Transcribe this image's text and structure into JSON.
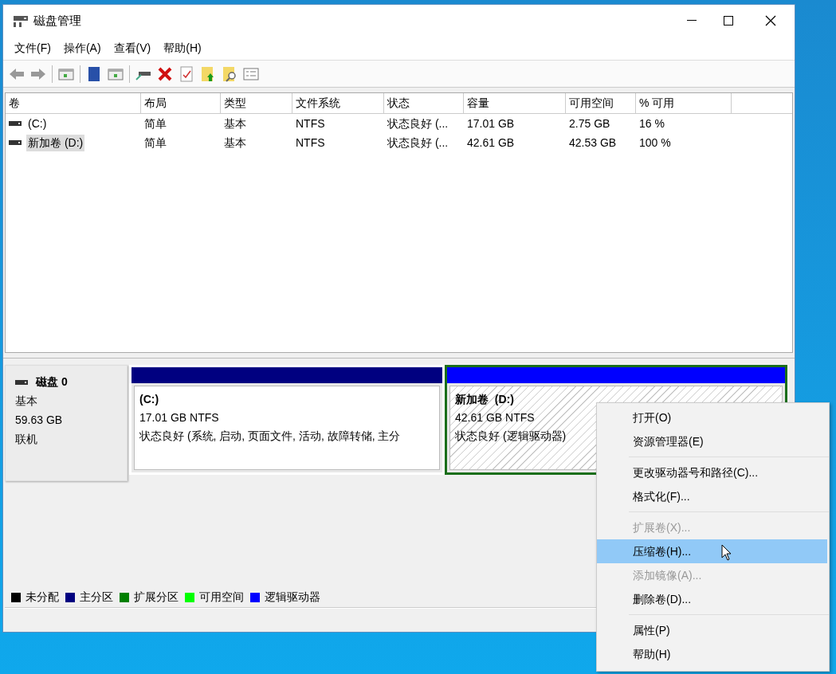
{
  "window": {
    "title": "磁盘管理"
  },
  "menu_bar": [
    "文件(F)",
    "操作(A)",
    "查看(V)",
    "帮助(H)"
  ],
  "table": {
    "columns": [
      "卷",
      "布局",
      "类型",
      "文件系统",
      "状态",
      "容量",
      "可用空间",
      "% 可用"
    ],
    "rows": [
      {
        "selected": false,
        "cells": [
          "(C:)",
          "简单",
          "基本",
          "NTFS",
          "状态良好 (...",
          "17.01 GB",
          "2.75 GB",
          "16 %"
        ]
      },
      {
        "selected": true,
        "cells": [
          "新加卷 (D:)",
          "简单",
          "基本",
          "NTFS",
          "状态良好 (...",
          "42.61 GB",
          "42.53 GB",
          "100 %"
        ]
      }
    ]
  },
  "disk": {
    "name": "磁盘 0",
    "type": "基本",
    "size": "59.63 GB",
    "status": "联机",
    "partitions": [
      {
        "name": "(C:)",
        "size": "17.01 GB NTFS",
        "status": "状态良好 (系统, 启动, 页面文件, 活动, 故障转储, 主分",
        "color": "#000080",
        "selected": false
      },
      {
        "name": "新加卷  (D:)",
        "size": "42.61 GB NTFS",
        "status": "状态良好 (逻辑驱动器)",
        "color": "#0000ff",
        "selected": true
      }
    ]
  },
  "legend": [
    {
      "label": "未分配",
      "color": "#000000"
    },
    {
      "label": "主分区",
      "color": "#000080"
    },
    {
      "label": "扩展分区",
      "color": "#008000"
    },
    {
      "label": "可用空间",
      "color": "#00ff00"
    },
    {
      "label": "逻辑驱动器",
      "color": "#0000ff"
    }
  ],
  "context_menu": {
    "groups": [
      [
        {
          "label": "打开(O)",
          "disabled": false,
          "selected": false
        },
        {
          "label": "资源管理器(E)",
          "disabled": false,
          "selected": false
        }
      ],
      [
        {
          "label": "更改驱动器号和路径(C)...",
          "disabled": false,
          "selected": false
        },
        {
          "label": "格式化(F)...",
          "disabled": false,
          "selected": false
        }
      ],
      [
        {
          "label": "扩展卷(X)...",
          "disabled": true,
          "selected": false
        },
        {
          "label": "压缩卷(H)...",
          "disabled": false,
          "selected": true
        },
        {
          "label": "添加镜像(A)...",
          "disabled": true,
          "selected": false
        },
        {
          "label": "删除卷(D)...",
          "disabled": false,
          "selected": false
        }
      ],
      [
        {
          "label": "属性(P)",
          "disabled": false,
          "selected": false
        },
        {
          "label": "帮助(H)",
          "disabled": false,
          "selected": false
        }
      ]
    ]
  }
}
